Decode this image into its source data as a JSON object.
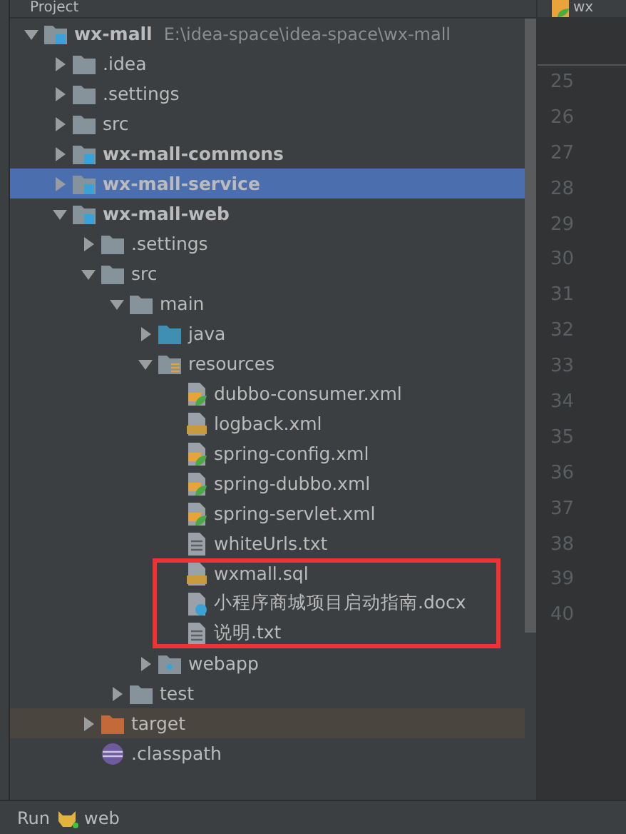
{
  "project_panel": {
    "title": "Project",
    "tree": [
      {
        "kind": "module",
        "name": "wx-mall",
        "path": "E:\\idea-space\\idea-space\\wx-mall",
        "expanded": true,
        "selected": false,
        "children": [
          {
            "kind": "folder",
            "name": ".idea",
            "expanded": false,
            "selected": false
          },
          {
            "kind": "folder",
            "name": ".settings",
            "expanded": false,
            "selected": false
          },
          {
            "kind": "folder",
            "name": "src",
            "expanded": false,
            "selected": false
          },
          {
            "kind": "module",
            "name": "wx-mall-commons",
            "expanded": false,
            "selected": false
          },
          {
            "kind": "module",
            "name": "wx-mall-service",
            "expanded": false,
            "selected": true
          },
          {
            "kind": "module",
            "name": "wx-mall-web",
            "expanded": true,
            "selected": false,
            "children": [
              {
                "kind": "folder",
                "name": ".settings",
                "expanded": false,
                "selected": false
              },
              {
                "kind": "folder",
                "name": "src",
                "expanded": true,
                "selected": false,
                "children": [
                  {
                    "kind": "folder",
                    "name": "main",
                    "expanded": true,
                    "selected": false,
                    "children": [
                      {
                        "kind": "source-folder",
                        "name": "java",
                        "expanded": false,
                        "selected": false
                      },
                      {
                        "kind": "resource-folder",
                        "name": "resources",
                        "expanded": true,
                        "selected": false,
                        "children": [
                          {
                            "kind": "spring-xml",
                            "name": "dubbo-consumer.xml",
                            "selected": false
                          },
                          {
                            "kind": "xml",
                            "name": "logback.xml",
                            "selected": false
                          },
                          {
                            "kind": "spring-xml",
                            "name": "spring-config.xml",
                            "selected": false
                          },
                          {
                            "kind": "spring-xml",
                            "name": "spring-dubbo.xml",
                            "selected": false
                          },
                          {
                            "kind": "spring-xml",
                            "name": "spring-servlet.xml",
                            "selected": false
                          },
                          {
                            "kind": "text",
                            "name": "whiteUrls.txt",
                            "selected": false
                          },
                          {
                            "kind": "sql",
                            "name": "wxmall.sql",
                            "selected": false
                          },
                          {
                            "kind": "unknown",
                            "name": "小程序商城项目启动指南.docx",
                            "selected": false
                          },
                          {
                            "kind": "text",
                            "name": "说明.txt",
                            "selected": false
                          }
                        ]
                      },
                      {
                        "kind": "web-folder",
                        "name": "webapp",
                        "expanded": false,
                        "selected": false
                      }
                    ]
                  },
                  {
                    "kind": "folder",
                    "name": "test",
                    "expanded": false,
                    "selected": false
                  }
                ]
              },
              {
                "kind": "excluded-folder",
                "name": "target",
                "expanded": false,
                "selected": false
              },
              {
                "kind": "eclipse",
                "name": ".classpath",
                "selected": false
              }
            ]
          }
        ]
      }
    ]
  },
  "editor": {
    "tab": "wx",
    "line_numbers": [
      "25",
      "26",
      "27",
      "28",
      "29",
      "30",
      "31",
      "32",
      "33",
      "34",
      "35",
      "36",
      "37",
      "38",
      "39",
      "40"
    ]
  },
  "run_bar": {
    "label": "Run",
    "config": "web"
  }
}
